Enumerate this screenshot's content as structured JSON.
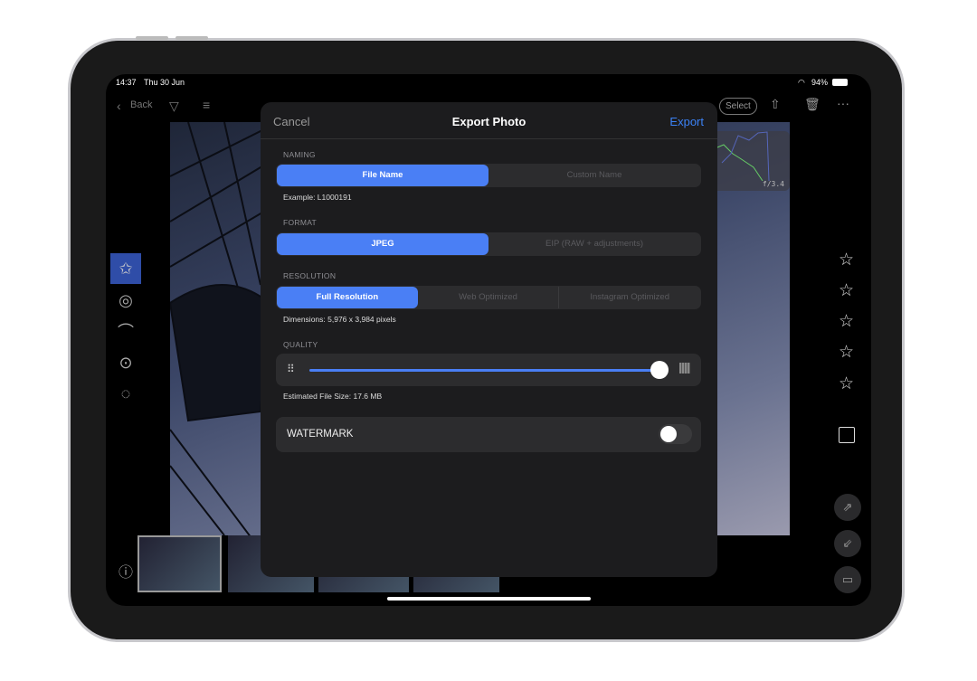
{
  "status": {
    "time": "14:37",
    "date": "Thu 30 Jun",
    "battery": "94%"
  },
  "nav": {
    "back": "Back",
    "select": "Select"
  },
  "histogram": {
    "aperture": "f/3.4"
  },
  "modal": {
    "cancel": "Cancel",
    "title": "Export Photo",
    "export": "Export",
    "naming": {
      "label": "NAMING",
      "options": [
        "File Name",
        "Custom Name"
      ],
      "selected": 0,
      "example": "Example: L1000191"
    },
    "format": {
      "label": "FORMAT",
      "options": [
        "JPEG",
        "EIP (RAW + adjustments)"
      ],
      "selected": 0
    },
    "resolution": {
      "label": "RESOLUTION",
      "options": [
        "Full Resolution",
        "Web Optimized",
        "Instagram Optimized"
      ],
      "selected": 0,
      "dimensions": "Dimensions: 5,976 x 3,984 pixels"
    },
    "quality": {
      "label": "QUALITY",
      "value": 1.0,
      "file_size": "Estimated File Size: 17.6 MB"
    },
    "watermark": {
      "label": "WATERMARK",
      "enabled": false
    }
  },
  "colors": {
    "accent": "#4a7ff5",
    "link": "#3b82f6"
  }
}
